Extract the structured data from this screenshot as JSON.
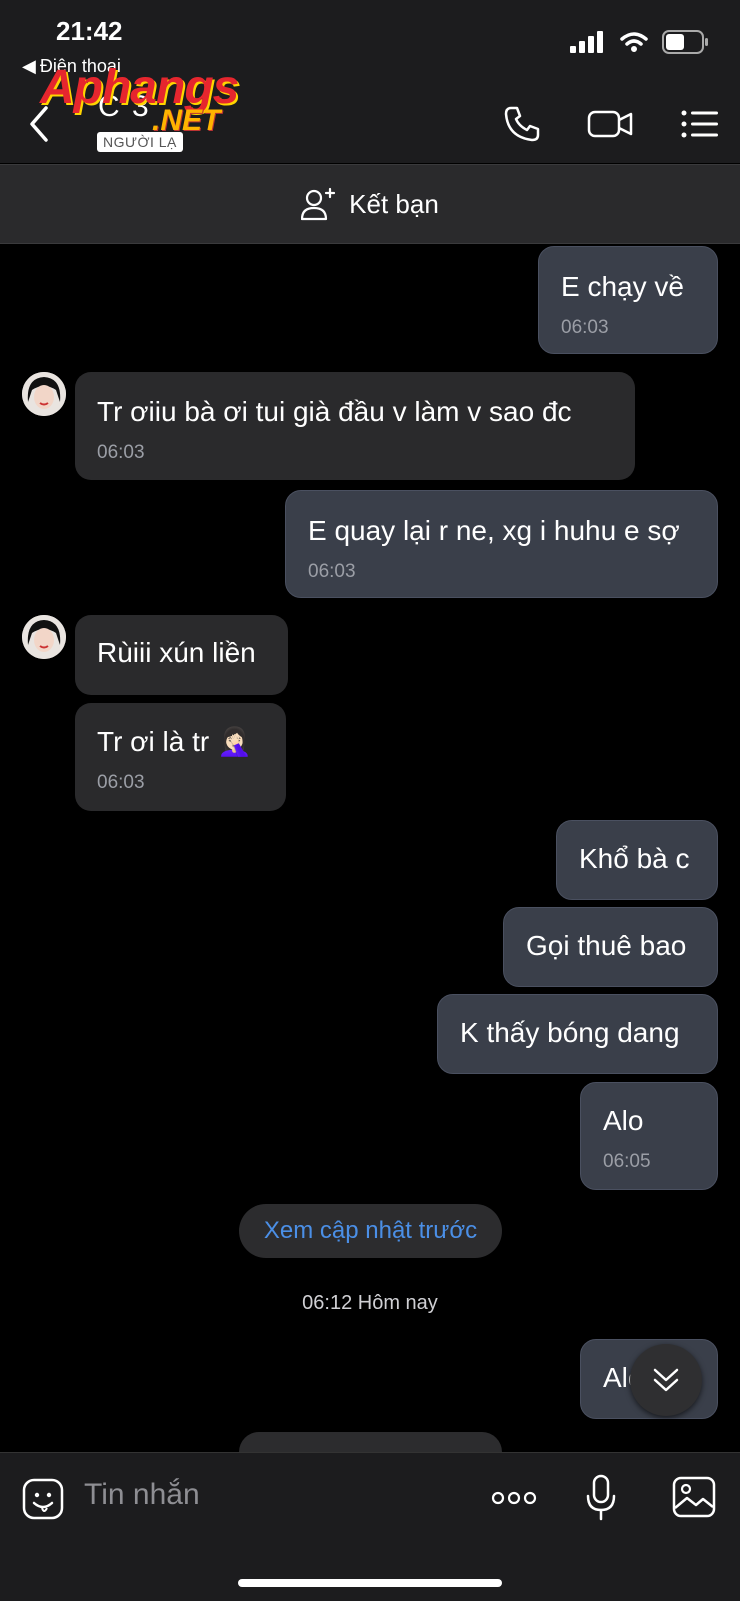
{
  "status": {
    "time": "21:42",
    "back_app": "Điện thoại"
  },
  "header": {
    "contact_name": "C 3",
    "badge": "NGƯỜI LẠ",
    "watermark_main": "Aphangs",
    "watermark_suffix": ".NET"
  },
  "friend_bar": {
    "label": "Kết bạn"
  },
  "messages": [
    {
      "dir": "out",
      "text": "E chạy về",
      "time": "06:03"
    },
    {
      "dir": "in",
      "text": "Tr ơiiu bà ơi tui già đầu v làm v sao đc",
      "time": "06:03"
    },
    {
      "dir": "out",
      "text": "E quay lại r ne, xg i huhu e sợ",
      "time": "06:03"
    },
    {
      "dir": "in",
      "text": "Rùiii xún liền",
      "time": ""
    },
    {
      "dir": "in",
      "text": "Tr ơi là tr 🤦🏻‍♀️",
      "time": "06:03"
    },
    {
      "dir": "out",
      "text": "Khổ bà c",
      "time": ""
    },
    {
      "dir": "out",
      "text": "Gọi thuê bao",
      "time": ""
    },
    {
      "dir": "out",
      "text": "K thấy bóng dang",
      "time": ""
    },
    {
      "dir": "out",
      "text": "Alo",
      "time": "06:05"
    },
    {
      "dir": "out",
      "text": "Alo",
      "time": ""
    }
  ],
  "see_updates": "Xem cập nhật trước",
  "day_stamp": "06:12 Hôm nay",
  "composer": {
    "placeholder": "Tin nhắn"
  },
  "icons": {
    "back": "chevron-left-icon",
    "call": "phone-icon",
    "video": "video-camera-icon",
    "menu": "list-menu-icon",
    "add_friend": "add-user-icon",
    "emoji": "emoji-icon",
    "more": "more-dots-icon",
    "mic": "microphone-icon",
    "image": "image-icon",
    "scroll": "double-chevron-down-icon"
  },
  "colors": {
    "link": "#4b8fe6",
    "outgoing_bubble": "#3a3f4a",
    "incoming_bubble": "#2a2a2c"
  }
}
